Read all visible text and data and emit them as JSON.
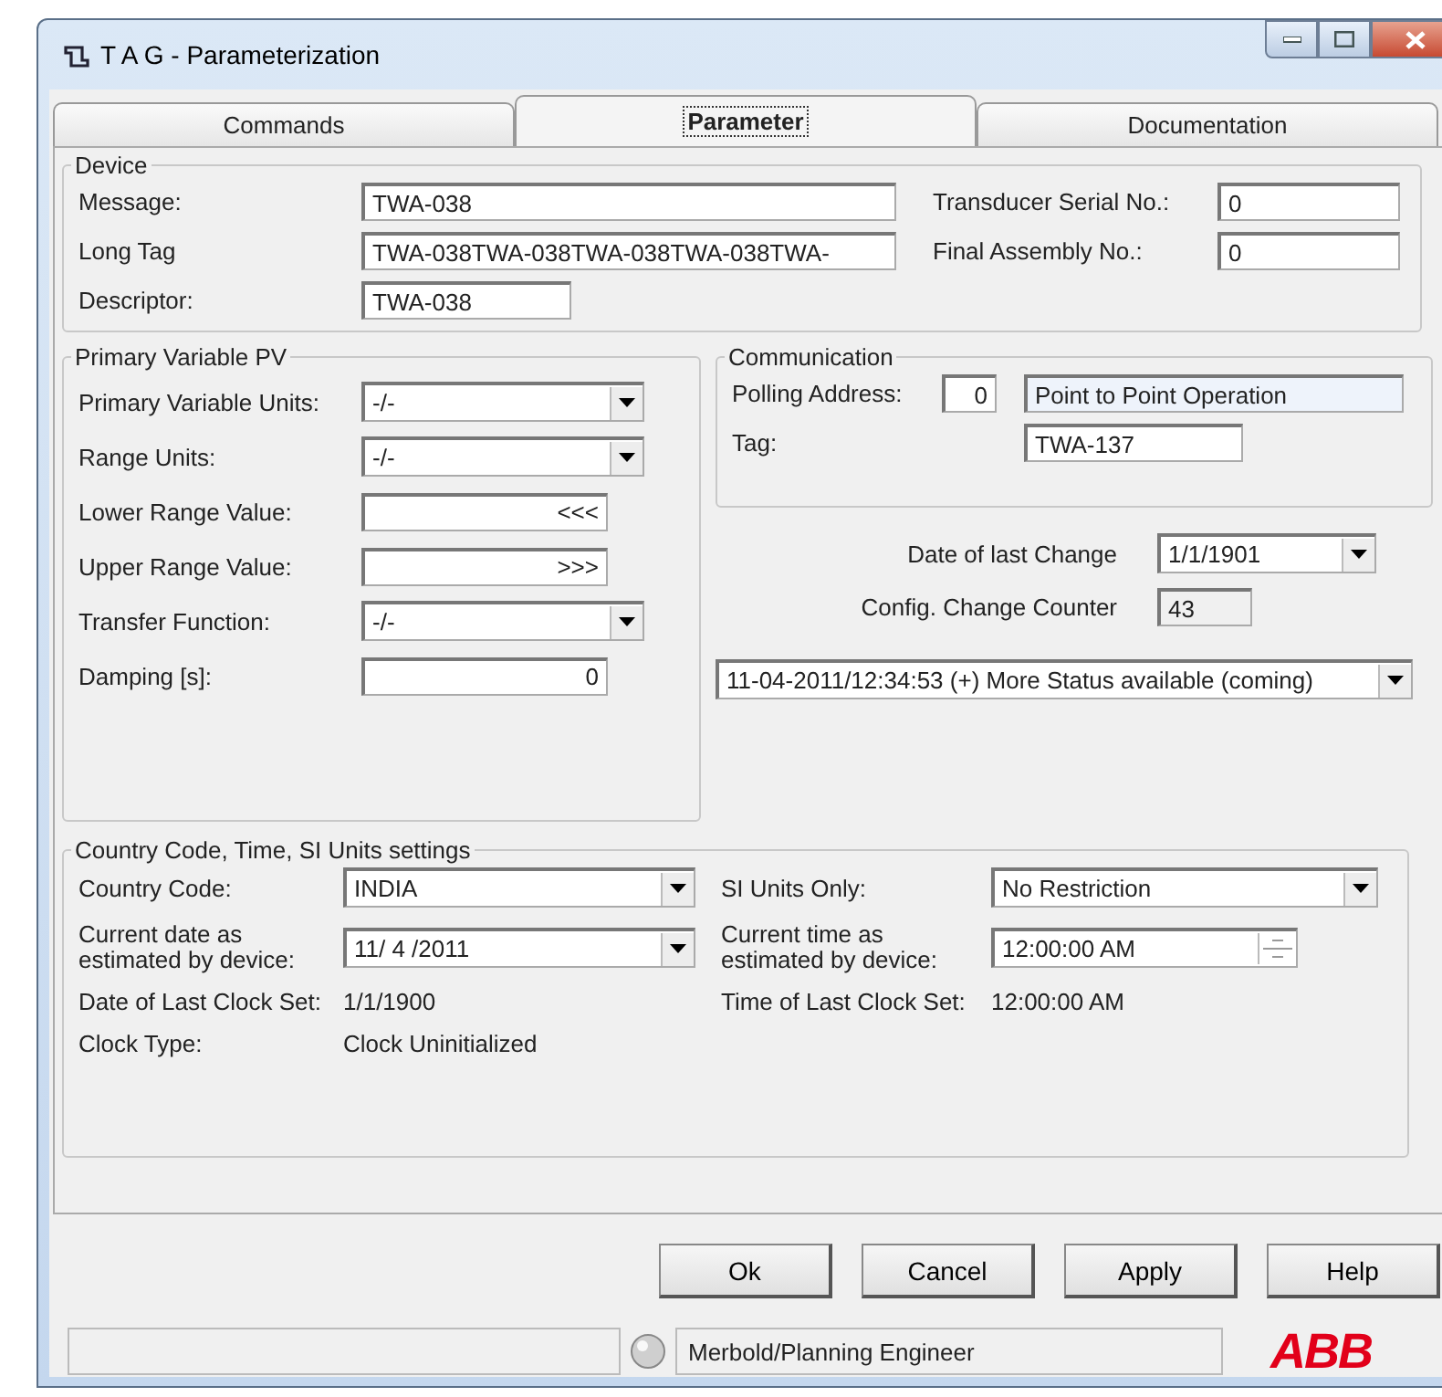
{
  "window": {
    "title": "T A G - Parameterization"
  },
  "tabs": [
    {
      "label": "Commands",
      "selected": false
    },
    {
      "label": "Parameter",
      "selected": true
    },
    {
      "label": "Documentation",
      "selected": false
    }
  ],
  "device": {
    "title": "Device",
    "message": {
      "label": "Message:",
      "value": "TWA-038"
    },
    "long_tag": {
      "label": "Long Tag",
      "value": "TWA-038TWA-038TWA-038TWA-038TWA-"
    },
    "descriptor": {
      "label": "Descriptor:",
      "value": "TWA-038"
    },
    "transducer_serial_no": {
      "label": "Transducer Serial No.:",
      "value": "0"
    },
    "final_assembly_no": {
      "label": "Final Assembly No.:",
      "value": "0"
    }
  },
  "primary_variable": {
    "title": "Primary Variable PV",
    "rows": [
      {
        "kind": "dropdown",
        "label": "Primary Variable Units:",
        "value": "-/-"
      },
      {
        "kind": "dropdown",
        "label": "Range Units:",
        "value": "-/-"
      },
      {
        "kind": "input",
        "label": "Lower Range Value:",
        "value": "<<<"
      },
      {
        "kind": "input",
        "label": "Upper Range Value:",
        "value": ">>>"
      },
      {
        "kind": "dropdown",
        "label": "Transfer Function:",
        "value": "-/-"
      },
      {
        "kind": "input",
        "label": "Damping [s]:",
        "value": "0"
      }
    ]
  },
  "communication": {
    "title": "Communication",
    "polling_address": {
      "label": "Polling Address:",
      "value": "0",
      "mode": "Point to Point Operation"
    },
    "tag": {
      "label": "Tag:",
      "value": "TWA-137"
    }
  },
  "date_of_last_change": {
    "label": "Date of last Change",
    "value": "1/1/1901"
  },
  "config_change_counter": {
    "label": "Config. Change Counter",
    "value": "43"
  },
  "status": {
    "value": "11-04-2011/12:34:53 (+) More Status available (coming)"
  },
  "country_settings": {
    "title": "Country Code, Time, SI Units settings",
    "country_code": {
      "label": "Country Code:",
      "value": "INDIA"
    },
    "si_units_only": {
      "label": "SI Units Only:",
      "value": "No Restriction"
    },
    "current_date": {
      "label": "Current date as\nestimated by device:",
      "value": "11/ 4 /2011"
    },
    "current_time": {
      "label": "Current time as\nestimated by device:",
      "value": "12:00:00 AM"
    },
    "date_of_last_clock_set": {
      "label": "Date of Last Clock Set:",
      "value": "1/1/1900"
    },
    "time_of_last_clock_set": {
      "label": "Time of Last Clock Set:",
      "value": "12:00:00 AM"
    },
    "clock_type": {
      "label": "Clock Type:",
      "value": "Clock Uninitialized"
    }
  },
  "buttons": [
    "Ok",
    "Cancel",
    "Apply",
    "Help"
  ],
  "status_bar": {
    "user": "Merbold/Planning Engineer",
    "logo": "ABB"
  }
}
